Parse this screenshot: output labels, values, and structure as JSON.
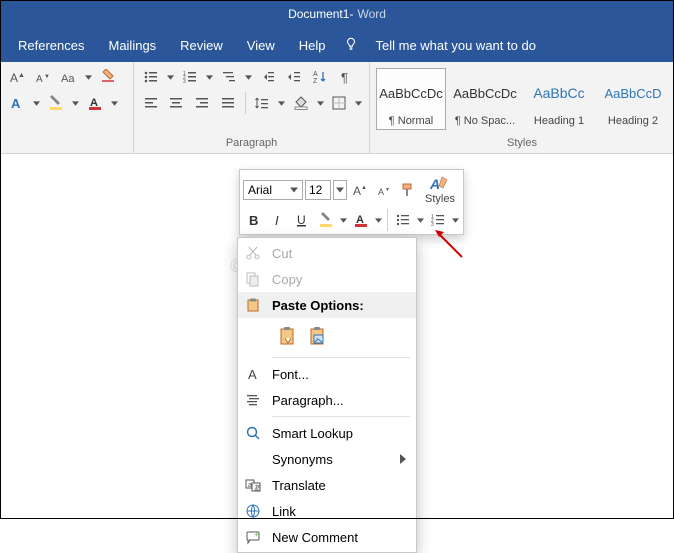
{
  "title": {
    "doc": "Document1",
    "sep": "  -  ",
    "app": "Word"
  },
  "menubar": {
    "references": "References",
    "mailings": "Mailings",
    "review": "Review",
    "view": "View",
    "help": "Help",
    "tell": "Tell me what you want to do"
  },
  "ribbon": {
    "paragraph_label": "Paragraph",
    "styles_label": "Styles",
    "styles": {
      "normal": {
        "sample": "AaBbCcDc",
        "name": "¶ Normal"
      },
      "nospace": {
        "sample": "AaBbCcDc",
        "name": "¶ No Spac..."
      },
      "heading1": {
        "sample": "AaBbCc",
        "name": "Heading 1"
      },
      "heading2": {
        "sample": "AaBbCcD",
        "name": "Heading 2"
      }
    }
  },
  "mini_toolbar": {
    "font_name": "Arial",
    "font_size": "12",
    "styles_label": "Styles"
  },
  "context_menu": {
    "cut": "Cut",
    "copy": "Copy",
    "paste_options": "Paste Options:",
    "font": "Font...",
    "paragraph": "Paragraph...",
    "smart_lookup": "Smart Lookup",
    "synonyms": "Synonyms",
    "translate": "Translate",
    "link": "Link",
    "new_comment": "New Comment"
  },
  "watermark": "©TheGeekPage.com"
}
